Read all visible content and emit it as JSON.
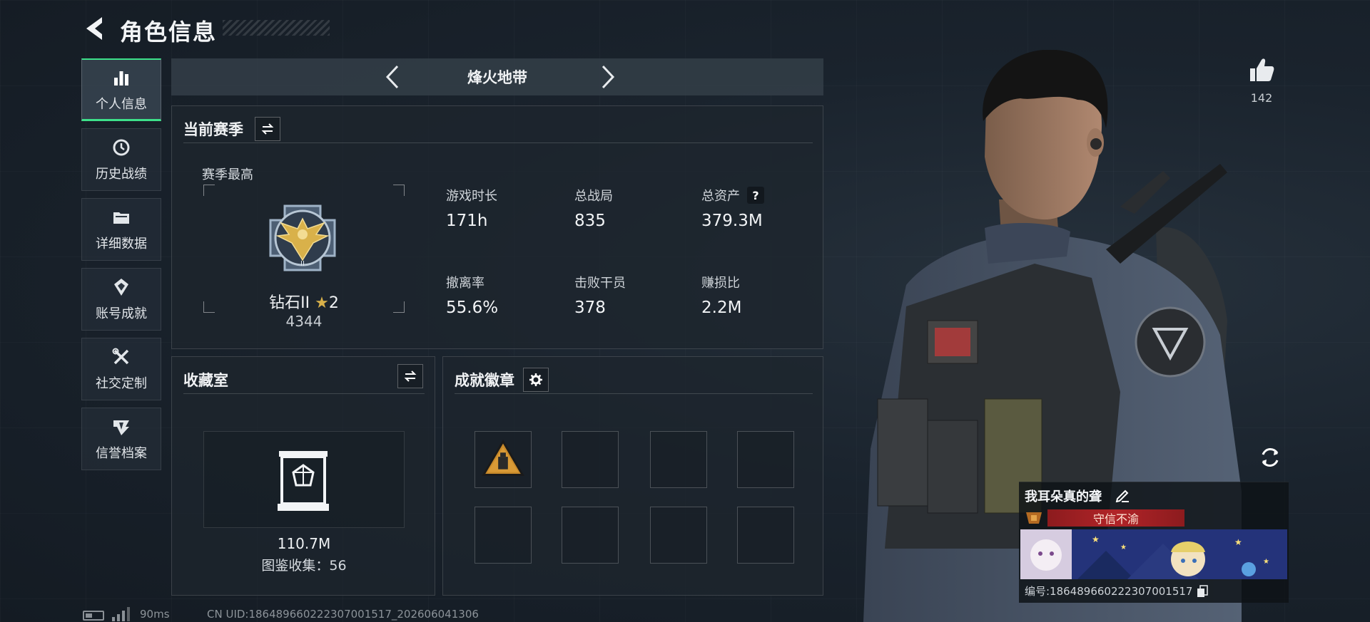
{
  "header": {
    "title": "角色信息"
  },
  "sidebar": {
    "items": [
      {
        "label": "个人信息",
        "icon": "bar-chart-icon",
        "active": true
      },
      {
        "label": "历史战绩",
        "icon": "history-clock-icon",
        "active": false
      },
      {
        "label": "详细数据",
        "icon": "folder-icon",
        "active": false
      },
      {
        "label": "账号成就",
        "icon": "achievement-icon",
        "active": false
      },
      {
        "label": "社交定制",
        "icon": "tools-icon",
        "active": false
      },
      {
        "label": "信誉档案",
        "icon": "credit-emblem-icon",
        "active": false
      }
    ]
  },
  "mode": {
    "title": "烽火地带"
  },
  "season": {
    "title": "当前赛季",
    "best_label": "赛季最高",
    "rank_name": "钻石II",
    "rank_stars": "2",
    "rank_score": "4344",
    "stats": [
      {
        "label": "游戏时长",
        "value": "171h"
      },
      {
        "label": "总战局",
        "value": "835"
      },
      {
        "label": "总资产",
        "value": "379.3M",
        "help": "?"
      },
      {
        "label": "撤离率",
        "value": "55.6%"
      },
      {
        "label": "击败干员",
        "value": "378"
      },
      {
        "label": "赚损比",
        "value": "2.2M"
      }
    ]
  },
  "collection": {
    "title": "收藏室",
    "value": "110.7M",
    "count_text": "图鉴收集：56"
  },
  "badges": {
    "title": "成就徽章"
  },
  "footer": {
    "ping": "90ms",
    "uid": "CN UID:18648966022230700151​7_202606041306"
  },
  "likes": {
    "count": "142"
  },
  "player_card": {
    "name": "我耳朵真的聋",
    "title": "守信不渝",
    "id_text": "编号:18648966022230700151​7"
  },
  "colors": {
    "accent_green": "#3de08a",
    "title_red": "#b12428",
    "rank_gold": "#d9b14a",
    "background": "#17202a"
  }
}
